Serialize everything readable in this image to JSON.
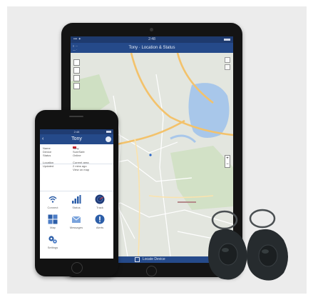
{
  "tablet": {
    "status_time": "2:48",
    "status_left": "••• ✦",
    "title": "Tony · Location & Status",
    "menu_lines": [
      "≡ ···",
      "— ·"
    ],
    "bottom_label": "Locate Device"
  },
  "phone": {
    "status_left": "••• ✦",
    "status_time": "2:48",
    "header_title": "Tony",
    "back_label": "‹",
    "info_rows": [
      {
        "key": "Name",
        "value": "Tony"
      },
      {
        "key": "Device",
        "value": "SureSafe"
      },
      {
        "key": "Status",
        "value": "Online"
      },
      {
        "key": "",
        "value": ""
      },
      {
        "key": "Location",
        "value": "Current area"
      },
      {
        "key": "Updated",
        "value": "2 mins ago"
      },
      {
        "key": "",
        "value": "View on map"
      }
    ],
    "tiles": [
      {
        "label": "Connect",
        "icon": "wifi-icon"
      },
      {
        "label": "Status",
        "icon": "signal-bars-icon"
      },
      {
        "label": "Track",
        "icon": "radar-icon"
      },
      {
        "label": "Map",
        "icon": "grid-map-icon"
      },
      {
        "label": "Messages",
        "icon": "mail-icon"
      },
      {
        "label": "Alerts",
        "icon": "alert-icon"
      },
      {
        "label": "Settings",
        "icon": "gears-icon"
      }
    ]
  },
  "colors": {
    "navy": "#254a8a",
    "navy_dark": "#1e3a6e",
    "map_road": "#f3c26b",
    "map_water": "#a8c7ea",
    "fob": "#262b2e"
  }
}
